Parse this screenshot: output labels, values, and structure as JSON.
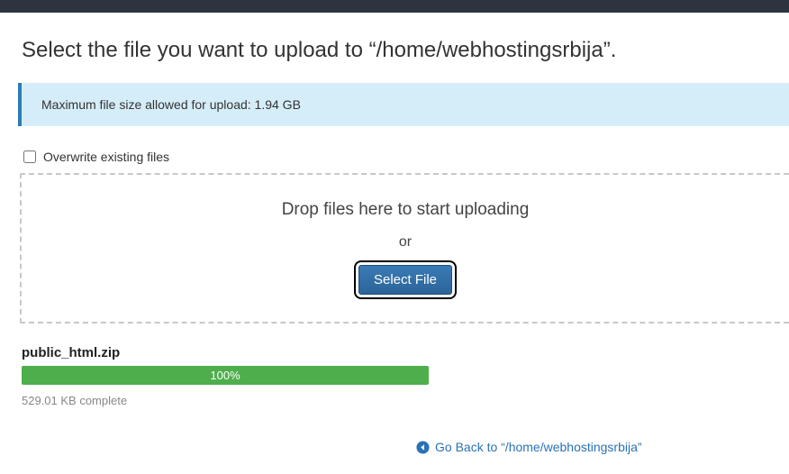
{
  "title": "Select the file you want to upload to “/home/webhostingsrbija”.",
  "banner": {
    "text": "Maximum file size allowed for upload: 1.94 GB"
  },
  "overwrite": {
    "label": "Overwrite existing files",
    "checked": false
  },
  "dropzone": {
    "text": "Drop files here to start uploading",
    "or": "or",
    "button": "Select File"
  },
  "upload": {
    "filename": "public_html.zip",
    "progress_label": "100%",
    "progress_percent": 100,
    "status": "529.01 KB complete"
  },
  "footer": {
    "back_label": "Go Back to “/home/webhostingsrbija”"
  }
}
